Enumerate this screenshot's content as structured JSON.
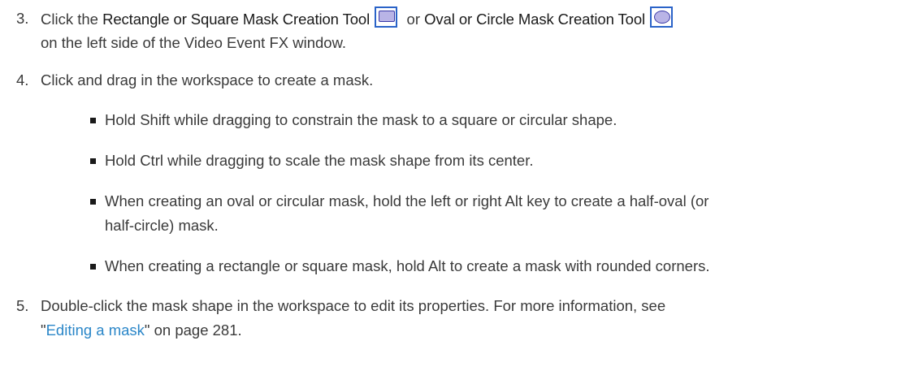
{
  "steps": [
    {
      "number": "3.",
      "pre": "Click the ",
      "tool1": "Rectangle or Square Mask Creation Tool",
      "tool1_icon": "rectangle-mask-tool-icon",
      "mid": " or ",
      "tool2": "Oval or Circle Mask Creation Tool",
      "tool2_icon": "oval-mask-tool-icon",
      "line2": "on the left side of the Video Event FX window."
    },
    {
      "number": "4.",
      "text": "Click and drag in the workspace to create a mask."
    },
    {
      "number": "5.",
      "line1": "Double-click the mask shape in the workspace to edit its properties. For more information, see",
      "quote_open": "\"",
      "link": "Editing a mask",
      "after_link": "\" on page 281."
    }
  ],
  "bullets": [
    "Hold Shift while dragging to constrain the mask to a square or circular shape.",
    "Hold Ctrl while dragging to scale the mask shape from its center.",
    "When creating an oval or circular mask, hold the left or right Alt key to create a half-oval (or",
    "half-circle) mask.",
    "When creating a rectangle or square mask, hold Alt to create a mask with rounded corners."
  ],
  "colors": {
    "text": "#3a3a3a",
    "link": "#2a86c8",
    "icon_border": "#2a63c8",
    "icon_fill": "#b9b4e6"
  }
}
